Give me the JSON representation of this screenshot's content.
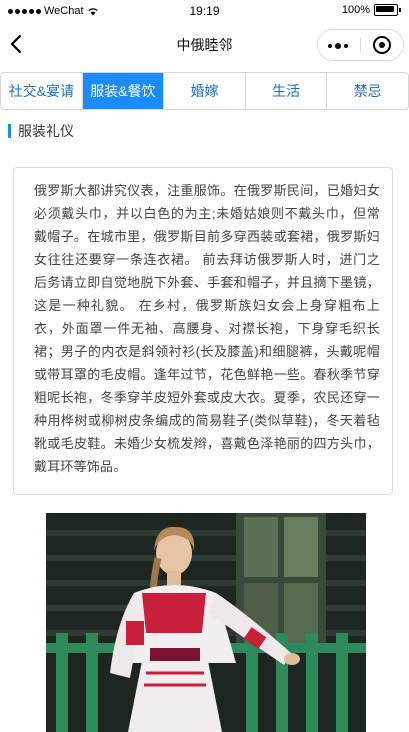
{
  "status_bar": {
    "carrier": "WeChat",
    "time": "19:19",
    "battery": "100%"
  },
  "nav": {
    "title": "中俄睦邻"
  },
  "tabs": [
    {
      "label": "社交&宴请",
      "active": false
    },
    {
      "label": "服装&餐饮",
      "active": true
    },
    {
      "label": "婚嫁",
      "active": false
    },
    {
      "label": "生活",
      "active": false
    },
    {
      "label": "禁忌",
      "active": false
    }
  ],
  "section": {
    "title": "服装礼仪"
  },
  "article": {
    "body": "俄罗斯大都讲究仪表，注重服饰。在俄罗斯民间，已婚妇女必须戴头巾，并以白色的为主;未婚姑娘则不戴头巾，但常戴帽子。在城市里，俄罗斯目前多穿西装或套裙，俄罗斯妇女往往还要穿一条连衣裙。 前去拜访俄罗斯人时，进门之后务请立即自觉地脱下外套、手套和帽子，并且摘下墨镜，这是一种礼貌。 在乡村，俄罗斯族妇女会上身穿粗布上衣，外面罩一件无袖、高腰身、对襟长袍，下身穿毛织长裙；男子的内衣是斜领衬衫(长及膝盖)和细腿裤，头戴呢帽或带耳罩的毛皮帽。逢年过节，花色鲜艳一些。春秋季节穿粗呢长袍，冬季穿羊皮短外套或皮大衣。夏季，农民还穿一种用桦树或柳树皮条编成的简易鞋子(类似草鞋)，冬天着毡靴或毛皮鞋。未婚少女梳发辫，喜戴色泽艳丽的四方头巾，戴耳环等饰品。"
  },
  "colors": {
    "accent": "#1a8cff",
    "tab_text": "#1a6fd6",
    "costume_red": "#c8203a"
  }
}
